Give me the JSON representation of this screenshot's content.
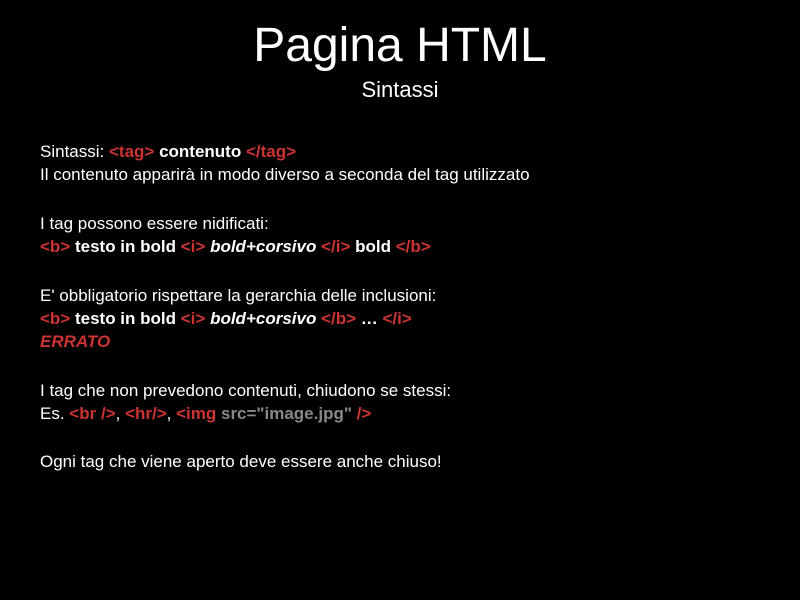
{
  "title": "Pagina HTML",
  "subtitle": "Sintassi",
  "b1": {
    "label": "Sintassi:  ",
    "open": "<tag>",
    "mid": " contenuto ",
    "close": "</tag>",
    "desc": "Il contenuto apparirà in modo diverso a seconda del tag utilizzato"
  },
  "b2": {
    "intro": "I tag possono essere nidificati:",
    "t1": "<b>",
    "t2": " testo in bold ",
    "t3": "<i>",
    "t4": " bold+corsivo ",
    "t5": "</i>",
    "t6": " bold ",
    "t7": "</b>"
  },
  "b3": {
    "intro": "E' obbligatorio rispettare la gerarchia delle inclusioni:",
    "t1": "<b>",
    "t2": " testo in bold ",
    "t3": "<i>",
    "t4": " bold+corsivo  ",
    "t5": "</b>",
    "t6": " … ",
    "t7": "</i>",
    "err": "ERRATO"
  },
  "b4": {
    "intro": "I tag che non prevedono contenuti, chiudono se stessi:",
    "es": "Es. ",
    "t1": "<br />",
    "c1": ", ",
    "t2": "<hr/>",
    "c2": ", ",
    "t3a": "<img ",
    "t3b": "src=\"image.jpg\"",
    "t3c": " />"
  },
  "b5": "Ogni tag che viene aperto deve essere anche chiuso!"
}
